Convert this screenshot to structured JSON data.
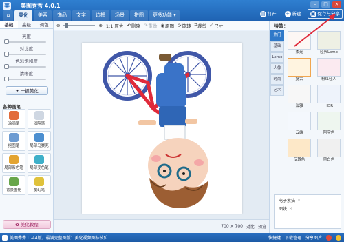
{
  "app": {
    "title": "美图秀秀 4.0.1"
  },
  "tabs": [
    {
      "label": "⌂",
      "name": "home"
    },
    {
      "label": "美化",
      "name": "beautify",
      "active": true
    },
    {
      "label": "美容",
      "name": "cosmetic"
    },
    {
      "label": "饰品",
      "name": "accessories"
    },
    {
      "label": "文字",
      "name": "text"
    },
    {
      "label": "边框",
      "name": "frame"
    },
    {
      "label": "场景",
      "name": "scene"
    },
    {
      "label": "拼图",
      "name": "collage"
    },
    {
      "label": "更多功能 ▾",
      "name": "more"
    }
  ],
  "top_actions": {
    "open": "打开",
    "new": "新建",
    "save": "保存与分享"
  },
  "left": {
    "subtabs": [
      "基础",
      "高级",
      "调色"
    ],
    "sliders": [
      {
        "label": "亮度",
        "value": 0
      },
      {
        "label": "对比度",
        "value": 0
      },
      {
        "label": "色彩饱和度",
        "value": 0
      },
      {
        "label": "清晰度",
        "value": 0
      }
    ],
    "onekey": "一键美化",
    "section_title": "各种画笔",
    "tools": [
      {
        "label": "涂鸦笔",
        "color": "#e26b3a"
      },
      {
        "label": "消除笔",
        "color": "#cfd7e2"
      },
      {
        "label": "抠图笔",
        "color": "#6c9bd2"
      },
      {
        "label": "局部马赛克",
        "color": "#4c8fd0"
      },
      {
        "label": "局部彩色笔",
        "color": "#e3a431"
      },
      {
        "label": "局部变色笔",
        "color": "#3fb0c9"
      },
      {
        "label": "背景虚化",
        "color": "#68a64a"
      },
      {
        "label": "魔幻笔",
        "color": "#e0c23b"
      }
    ],
    "beauty_btn": "美化教程"
  },
  "toolbar": {
    "zoom_label": "1:1 原大",
    "rotate": "删除",
    "redo": "重做",
    "original": "原图",
    "rotate_btn": "旋转",
    "crop": "裁剪",
    "resize": "尺寸"
  },
  "status": {
    "size": "700 × 700",
    "compare": "对比",
    "preview": "预览"
  },
  "right": {
    "title": "特效：",
    "categories": [
      "热门",
      "基础",
      "Lomo",
      "人像",
      "时尚",
      "艺术"
    ],
    "effects": [
      {
        "label": "柔光"
      },
      {
        "label": "经典Lomo"
      },
      {
        "label": "复古",
        "selected": true
      },
      {
        "label": "粉红佳人"
      },
      {
        "label": "淡雅"
      },
      {
        "label": "HDR"
      },
      {
        "label": "云端"
      },
      {
        "label": "阿宝色"
      },
      {
        "label": "反转色"
      },
      {
        "label": "黑白色"
      }
    ],
    "applied": [
      "电子素描",
      "图块"
    ]
  },
  "statusbar": {
    "left": "美图秀秀 IT-44版，最满完整图版：美化视频图标技位",
    "right1": "快捷键",
    "right2": "下载管理",
    "right3": "分享图片"
  },
  "colors": {
    "accent": "#1f63b3",
    "bike_red": "#e02a3a",
    "bike_blue": "#4057a8"
  }
}
